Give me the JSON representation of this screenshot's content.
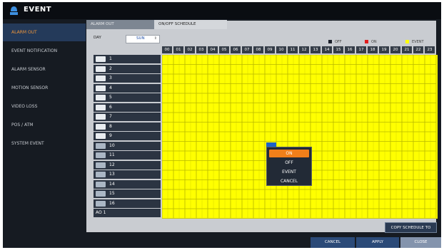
{
  "window": {
    "title": "EVENT",
    "icon": "camera-icon"
  },
  "sidebar": {
    "items": [
      {
        "label": "ALARM OUT",
        "active": true
      },
      {
        "label": "EVENT NOTIFICATION",
        "active": false
      },
      {
        "label": "ALARM SENSOR",
        "active": false
      },
      {
        "label": "MOTION SENSOR",
        "active": false
      },
      {
        "label": "VIDEO LOSS",
        "active": false
      },
      {
        "label": "POS / ATM",
        "active": false
      },
      {
        "label": "SYSTEM EVENT",
        "active": false
      }
    ]
  },
  "tabs": {
    "alarm_out": "ALARM OUT",
    "schedule": "ON/OFF SCHEDULE"
  },
  "day": {
    "label": "DAY",
    "value": "SUN",
    "arrow": "⇕"
  },
  "legend": [
    {
      "label": "OFF",
      "color": "#1a1f2a"
    },
    {
      "label": "ON",
      "color": "#e21c1c"
    },
    {
      "label": "EVENT",
      "color": "#ffff00"
    }
  ],
  "hours": [
    "00",
    "01",
    "02",
    "03",
    "04",
    "05",
    "06",
    "07",
    "08",
    "09",
    "10",
    "11",
    "12",
    "13",
    "14",
    "15",
    "16",
    "17",
    "18",
    "19",
    "20",
    "21",
    "22",
    "23"
  ],
  "rows": [
    {
      "label": "1",
      "icon": "camera-channel-icon"
    },
    {
      "label": "2",
      "icon": "camera-channel-icon"
    },
    {
      "label": "3",
      "icon": "camera-channel-icon"
    },
    {
      "label": "4",
      "icon": "camera-channel-icon"
    },
    {
      "label": "5",
      "icon": "camera-channel-icon"
    },
    {
      "label": "6",
      "icon": "camera-channel-icon"
    },
    {
      "label": "7",
      "icon": "camera-channel-icon"
    },
    {
      "label": "8",
      "icon": "camera-channel-icon"
    },
    {
      "label": "9",
      "icon": "camera-channel-icon"
    },
    {
      "label": "10",
      "icon": "sensor-channel-icon"
    },
    {
      "label": "11",
      "icon": "sensor-channel-icon"
    },
    {
      "label": "12",
      "icon": "sensor-channel-icon"
    },
    {
      "label": "13",
      "icon": "sensor-channel-icon"
    },
    {
      "label": "14",
      "icon": "sensor-channel-icon"
    },
    {
      "label": "15",
      "icon": "sensor-channel-icon"
    },
    {
      "label": "16",
      "icon": "sensor-channel-icon"
    },
    {
      "label": "AO 1",
      "icon": ""
    }
  ],
  "grid": {
    "default_value": "EVENT",
    "cell_color": "#ffff00",
    "selected_cell": {
      "row": "10",
      "hour": "09"
    }
  },
  "popup": {
    "items": [
      "ON",
      "OFF",
      "EVENT",
      "CANCEL"
    ],
    "selected": "ON"
  },
  "buttons": {
    "copy_schedule": "COPY SCHEDULE TO",
    "cancel": "CANCEL",
    "apply": "APPLY",
    "close": "CLOSE"
  },
  "colors": {
    "accent": "#f07f1a",
    "event": "#ffff00",
    "panel": "#c9ccd1",
    "button": "#2a3a52"
  }
}
